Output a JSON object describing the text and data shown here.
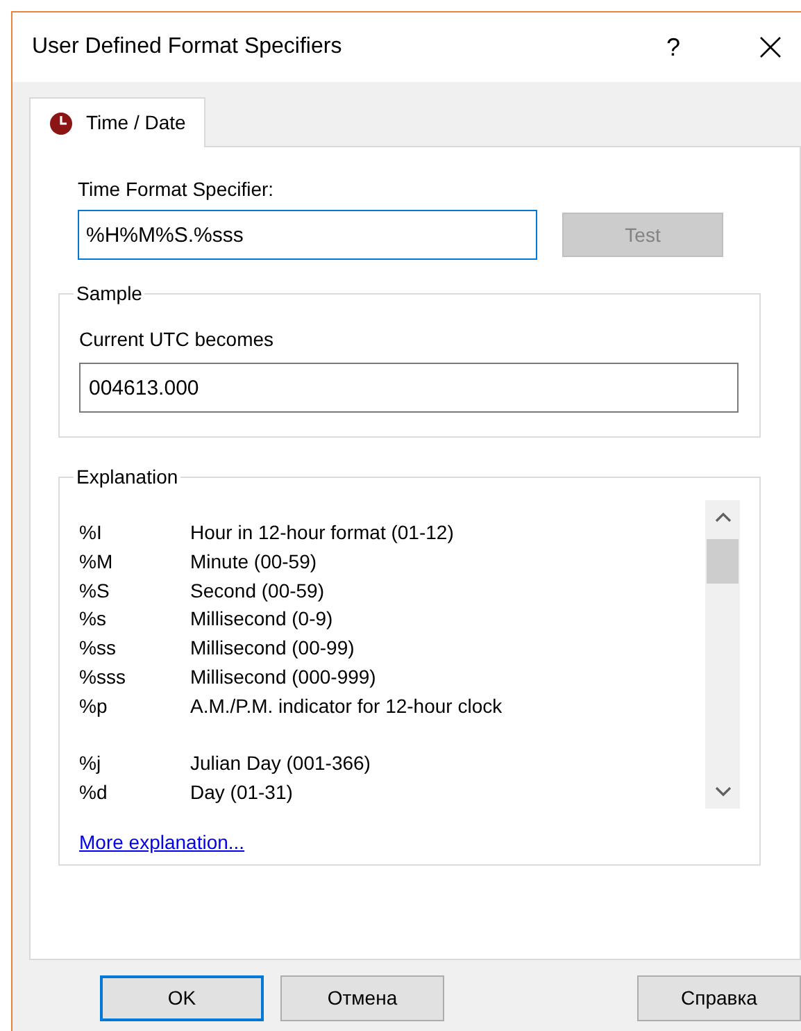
{
  "window": {
    "title": "User Defined Format Specifiers",
    "help": "?"
  },
  "tabs": [
    {
      "label": "Time / Date",
      "selected": true
    }
  ],
  "time_format": {
    "label": "Time Format Specifier:",
    "value": "%H%M%S.%sss",
    "test_button": {
      "label": "Test",
      "disabled": true
    }
  },
  "sample": {
    "title": "Sample",
    "label": "Current UTC becomes",
    "value": "004613.000"
  },
  "explanation": {
    "title": "Explanation",
    "groups": [
      [
        {
          "code": "%I",
          "text": "Hour in 12-hour format (01-12)"
        },
        {
          "code": "%M",
          "text": "Minute (00-59)"
        },
        {
          "code": "%S",
          "text": "Second (00-59)"
        },
        {
          "code": "%s",
          "text": "Millisecond (0-9)"
        },
        {
          "code": "%ss",
          "text": "Millisecond (00-99)"
        },
        {
          "code": "%sss",
          "text": "Millisecond (000-999)"
        },
        {
          "code": "%p",
          "text": "A.M./P.M. indicator for 12-hour clock"
        }
      ],
      [
        {
          "code": "%j",
          "text": "Julian Day (001-366)"
        },
        {
          "code": "%d",
          "text": "Day (01-31)"
        }
      ]
    ],
    "link": "More explanation..."
  },
  "buttons": [
    {
      "label": "OK",
      "default": true
    },
    {
      "label": "Отмена",
      "default": false
    },
    {
      "label": "Справка",
      "default": false
    }
  ]
}
